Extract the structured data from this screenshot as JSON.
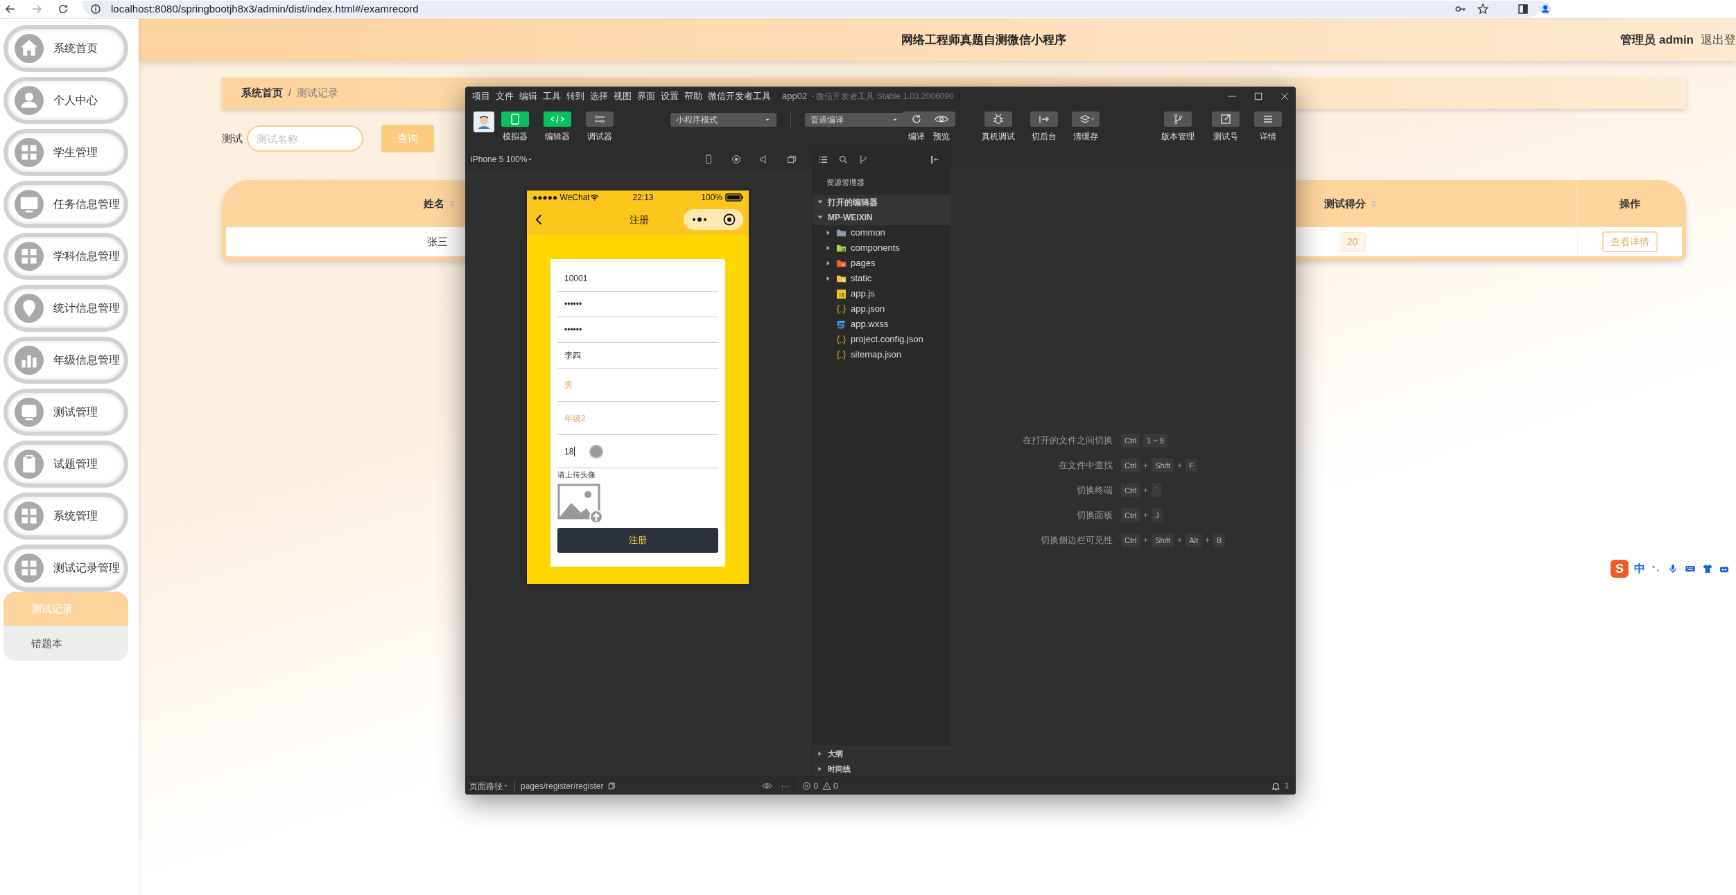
{
  "browser": {
    "url": "localhost:8080/springbootjh8x3/admin/dist/index.html#/examrecord"
  },
  "sidebar": {
    "items": [
      {
        "label": "系统首页"
      },
      {
        "label": "个人中心"
      },
      {
        "label": "学生管理"
      },
      {
        "label": "任务信息管理"
      },
      {
        "label": "学科信息管理"
      },
      {
        "label": "统计信息管理"
      },
      {
        "label": "年级信息管理"
      },
      {
        "label": "测试管理"
      },
      {
        "label": "试题管理"
      },
      {
        "label": "系统管理"
      },
      {
        "label": "测试记录管理",
        "children": [
          {
            "label": "测试记录",
            "selected": true
          },
          {
            "label": "错题本",
            "selected": false
          }
        ]
      }
    ]
  },
  "header": {
    "title": "网络工程师真题自测微信小程序",
    "user": "管理员 admin",
    "logout": "退出登"
  },
  "breadcrumb": {
    "items": [
      "系统首页",
      "测试记录"
    ],
    "separator": "/"
  },
  "search": {
    "label": "测试",
    "placeholder": "测试名称",
    "button": "查询"
  },
  "table": {
    "columns": [
      {
        "label": "姓名",
        "sortable": true
      },
      {
        "label": "测试得分",
        "sortable": true
      },
      {
        "label": "操作",
        "sortable": false
      }
    ],
    "rows": [
      {
        "name": "张三",
        "score": "20",
        "action": "查看详情"
      }
    ]
  },
  "devtools": {
    "menu": [
      "项目",
      "文件",
      "编辑",
      "工具",
      "转到",
      "选择",
      "视图",
      "界面",
      "设置",
      "帮助",
      "微信开发者工具"
    ],
    "title": "app02",
    "subtitle": "- 微信开发者工具 Stable 1.03.2006090",
    "views": [
      {
        "label": "模拟器",
        "active": true
      },
      {
        "label": "编辑器",
        "active": true
      },
      {
        "label": "调试器",
        "active": false
      }
    ],
    "mode": "小程序模式",
    "compile": "普通编译",
    "actions": [
      {
        "label": "编译"
      },
      {
        "label": "预览"
      },
      {
        "label": "真机调试"
      },
      {
        "label": "切后台"
      },
      {
        "label": "清缓存"
      }
    ],
    "right_actions": [
      {
        "label": "版本管理"
      },
      {
        "label": "测试号"
      },
      {
        "label": "详情"
      }
    ],
    "device": "iPhone 5 100%",
    "phone": {
      "carrier": "●●●●● WeChat",
      "time": "22:13",
      "battery": "100%",
      "nav_title": "注册",
      "fields": [
        {
          "kind": "input",
          "value": "10001",
          "focused": false
        },
        {
          "kind": "input",
          "value": "••••••",
          "focused": false
        },
        {
          "kind": "input",
          "value": "••••••",
          "focused": false
        },
        {
          "kind": "input",
          "value": "李四",
          "focused": false
        },
        {
          "kind": "picker",
          "value": "男",
          "focused": false
        },
        {
          "kind": "picker",
          "value": "年级2",
          "focused": false
        },
        {
          "kind": "input",
          "value": "18",
          "focused": true
        }
      ],
      "upload_label": "请上传头像",
      "submit": "注册"
    },
    "explorer": {
      "title": "资源管理器",
      "sections": [
        {
          "label": "打开的编辑器",
          "expanded": true
        },
        {
          "label": "MP-WEIXIN",
          "expanded": true,
          "children": [
            {
              "kind": "folder-plain",
              "label": "common",
              "expanded": false
            },
            {
              "kind": "folder-components",
              "label": "components",
              "expanded": false
            },
            {
              "kind": "folder-pages",
              "label": "pages",
              "expanded": false
            },
            {
              "kind": "folder-static",
              "label": "static",
              "expanded": false
            },
            {
              "kind": "js",
              "label": "app.js"
            },
            {
              "kind": "json",
              "label": "app.json"
            },
            {
              "kind": "css",
              "label": "app.wxss"
            },
            {
              "kind": "json",
              "label": "project.config.json"
            },
            {
              "kind": "json",
              "label": "sitemap.json"
            }
          ]
        }
      ],
      "bottom_sections": [
        {
          "label": "大纲",
          "expanded": false
        },
        {
          "label": "时间线",
          "expanded": false
        }
      ]
    },
    "shortcuts": [
      {
        "label": "在打开的文件之间切换",
        "parts": [
          {
            "kind": "key",
            "text": "Ctrl"
          },
          {
            "kind": "key",
            "text": "1 ~ 9"
          }
        ]
      },
      {
        "label": "在文件中查找",
        "parts": [
          {
            "kind": "key",
            "text": "Ctrl"
          },
          {
            "kind": "plus",
            "text": "+"
          },
          {
            "kind": "key",
            "text": "Shift"
          },
          {
            "kind": "plus",
            "text": "+"
          },
          {
            "kind": "key",
            "text": "F"
          }
        ]
      },
      {
        "label": "切换终端",
        "parts": [
          {
            "kind": "key",
            "text": "Ctrl"
          },
          {
            "kind": "plus",
            "text": "+"
          },
          {
            "kind": "key",
            "text": "`"
          }
        ]
      },
      {
        "label": "切换面板",
        "parts": [
          {
            "kind": "key",
            "text": "Ctrl"
          },
          {
            "kind": "plus",
            "text": "+"
          },
          {
            "kind": "key",
            "text": "J"
          }
        ]
      },
      {
        "label": "切换侧边栏可见性",
        "parts": [
          {
            "kind": "key",
            "text": "Ctrl"
          },
          {
            "kind": "plus",
            "text": "+"
          },
          {
            "kind": "key",
            "text": "Shift"
          },
          {
            "kind": "plus",
            "text": "+"
          },
          {
            "kind": "key",
            "text": "Alt"
          },
          {
            "kind": "plus",
            "text": "+"
          },
          {
            "kind": "key",
            "text": "B"
          }
        ]
      }
    ],
    "status": {
      "path_label": "页面路径",
      "path": "pages/register/register",
      "more": "···",
      "errors": "0",
      "warnings": "0",
      "notifications": "1"
    }
  },
  "ime": {
    "logo": "S",
    "mode": "中"
  }
}
